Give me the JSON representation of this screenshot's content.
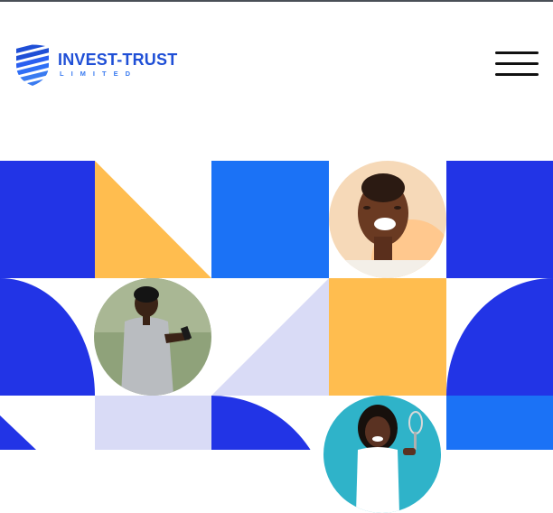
{
  "brand": {
    "name": "INVEST-TRUST",
    "tagline": "LIMITED",
    "logo_icon": "shield-stripes-icon",
    "colors": {
      "primary": "#1f4fd6",
      "secondary": "#3a7bf0"
    }
  },
  "header": {
    "menu_icon": "hamburger-menu-icon"
  },
  "mosaic": {
    "colors": {
      "royal_blue": "#2234e6",
      "sky_blue": "#1b72f6",
      "amber": "#ffbd4f",
      "lavender": "#d9dbf6",
      "white": "#ffffff"
    },
    "photos": [
      "laughing-woman-photo",
      "man-with-phone-photo",
      "woman-with-whisk-photo"
    ]
  }
}
